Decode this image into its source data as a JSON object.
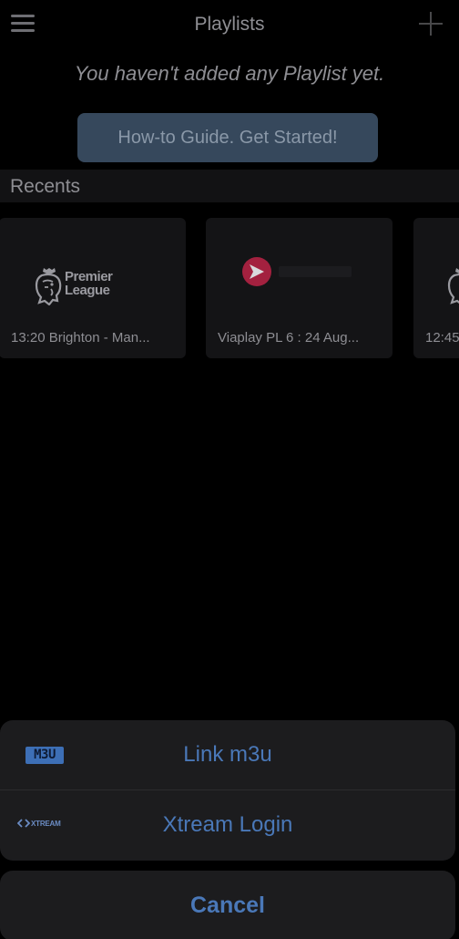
{
  "header": {
    "title": "Playlists",
    "menu_icon": "hamburger-menu-icon",
    "add_icon": "plus-icon"
  },
  "empty_message": "You haven't added any Playlist yet.",
  "guide_button": {
    "label": "How-to Guide. Get Started!"
  },
  "recents": {
    "title": "Recents",
    "items": [
      {
        "label": "13:20 Brighton - Man...",
        "logo": "premier-league-logo",
        "logo_text": [
          "Premier",
          "League"
        ]
      },
      {
        "label": "Viaplay PL 6 : 24 Aug...",
        "logo": "viaplay-logo"
      },
      {
        "label": "12:45",
        "logo": "premier-league-logo"
      }
    ]
  },
  "action_sheet": {
    "items": [
      {
        "label": "Link m3u",
        "badge": "M3U",
        "icon": "m3u-badge-icon"
      },
      {
        "label": "Xtream Login",
        "badge": "XTREAM",
        "icon": "xtream-logo-icon"
      }
    ],
    "cancel_label": "Cancel"
  },
  "colors": {
    "background": "#000000",
    "text_muted": "#8e8e93",
    "accent_blue": "#4a78b8",
    "guide_button_bg": "#36485c",
    "sheet_bg": "#1c1c1e",
    "viaplay_red": "#a3213f"
  }
}
